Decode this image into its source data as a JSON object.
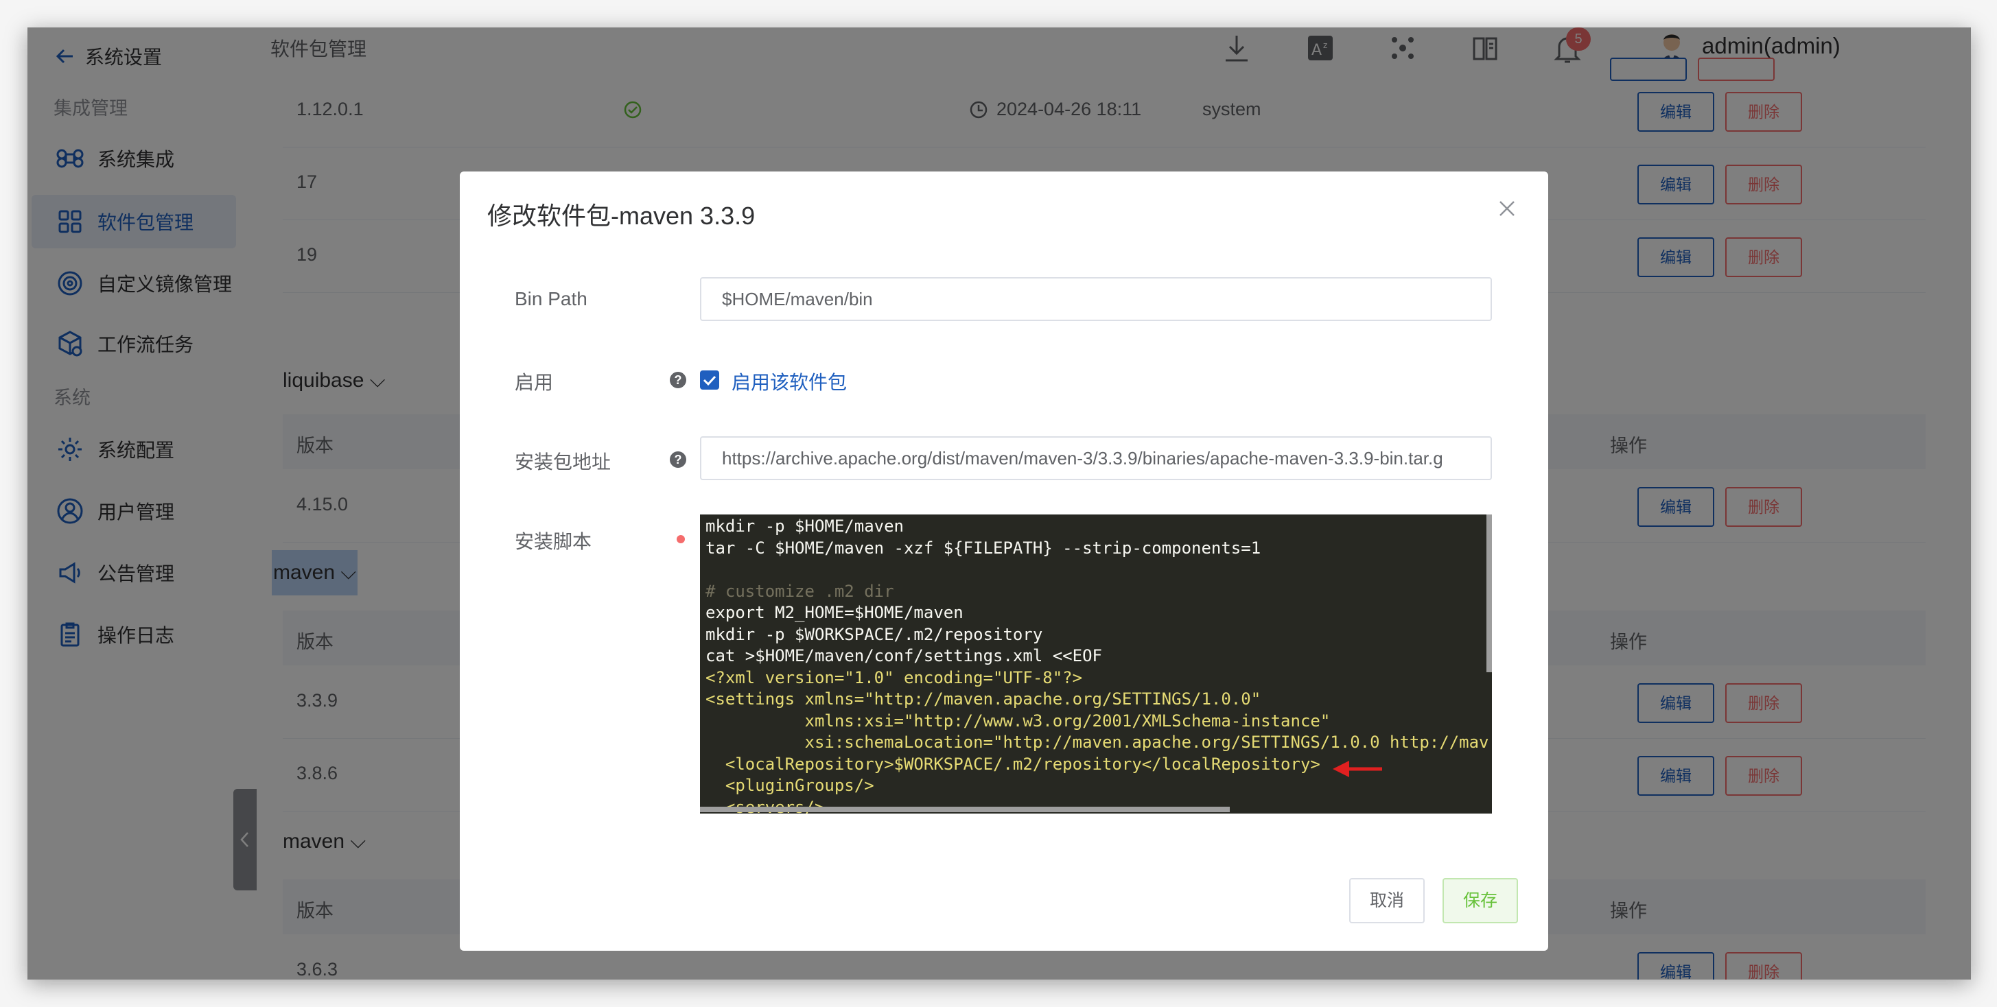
{
  "sidebar": {
    "back_label": "系统设置",
    "group_integration": "集成管理",
    "group_system": "系统",
    "items": [
      {
        "label": "系统集成",
        "icon": "command-icon"
      },
      {
        "label": "软件包管理",
        "icon": "grid-icon",
        "active": true
      },
      {
        "label": "自定义镜像管理",
        "icon": "disc-icon"
      },
      {
        "label": "工作流任务",
        "icon": "cube-gear-icon"
      },
      {
        "label": "系统配置",
        "icon": "gear-icon"
      },
      {
        "label": "用户管理",
        "icon": "user-icon"
      },
      {
        "label": "公告管理",
        "icon": "megaphone-icon"
      },
      {
        "label": "操作日志",
        "icon": "clipboard-icon"
      }
    ]
  },
  "header": {
    "breadcrumb": "软件包管理",
    "notification_count": "5",
    "username": "admin(admin)"
  },
  "table": {
    "col_version": "版本",
    "col_actions": "操作",
    "edit_label": "编辑",
    "delete_label": "删除",
    "top_rows": [
      {
        "version": "1.12.0.1",
        "status": "enabled",
        "time": "2024-04-26 18:11",
        "creator": "system"
      },
      {
        "version": "17"
      },
      {
        "version": "19"
      }
    ],
    "groups": [
      {
        "name": "liquibase",
        "rows": [
          {
            "version": "4.15.0"
          }
        ]
      },
      {
        "name": "maven",
        "rows": [
          {
            "version": "3.3.9"
          },
          {
            "version": "3.8.6"
          }
        ]
      },
      {
        "name": "maven",
        "rows": [
          {
            "version": "3.6.3"
          }
        ]
      }
    ]
  },
  "dialog": {
    "title": "修改软件包-maven 3.3.9",
    "bin_path_label": "Bin Path",
    "bin_path_value": "$HOME/maven/bin",
    "enable_label": "启用",
    "enable_checkbox_label": "启用该软件包",
    "enable_checked": true,
    "url_label": "安装包地址",
    "url_value": "https://archive.apache.org/dist/maven/maven-3/3.3.9/binaries/apache-maven-3.3.9-bin.tar.g",
    "script_label": "安装脚本",
    "script_lines": [
      "mkdir -p $HOME/maven",
      "tar -C $HOME/maven -xzf ${FILEPATH} --strip-components=1",
      "",
      "# customize .m2 dir",
      "export M2_HOME=$HOME/maven",
      "mkdir -p $WORKSPACE/.m2/repository",
      "cat >$HOME/maven/conf/settings.xml <<EOF",
      "<?xml version=\"1.0\" encoding=\"UTF-8\"?>",
      "<settings xmlns=\"http://maven.apache.org/SETTINGS/1.0.0\"",
      "          xmlns:xsi=\"http://www.w3.org/2001/XMLSchema-instance\"",
      "          xsi:schemaLocation=\"http://maven.apache.org/SETTINGS/1.0.0 http://mav",
      "  <localRepository>$WORKSPACE/.m2/repository</localRepository>",
      "  <pluginGroups/>",
      "  <servers/>"
    ],
    "cancel_label": "取消",
    "save_label": "保存"
  },
  "colors": {
    "primary": "#1f5fbf",
    "danger": "#f56c6c",
    "success": "#67c23a",
    "editor_bg": "#272822",
    "annotation_arrow": "#e02020"
  }
}
